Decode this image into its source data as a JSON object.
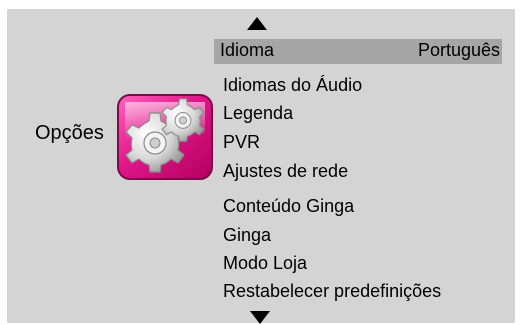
{
  "panel": {
    "title": "Opções",
    "icon": "gears-icon",
    "colors": {
      "panel_background": "#d4d4d4",
      "selection": "#a6a6a6",
      "accent": "#e0178a"
    }
  },
  "menu": {
    "items": [
      {
        "label": "Idioma",
        "value": "Português",
        "selected": true
      },
      {
        "label": "Idiomas do Áudio"
      },
      {
        "label": "Legenda"
      },
      {
        "label": "PVR"
      },
      {
        "label": "Ajustes de rede"
      },
      {
        "label": "Conteúdo Ginga"
      },
      {
        "label": "Ginga"
      },
      {
        "label": "Modo Loja"
      },
      {
        "label": "Restabelecer predefinições"
      }
    ]
  },
  "navigation": {
    "up_icon": "up-arrow-icon",
    "down_icon": "down-arrow-icon"
  }
}
